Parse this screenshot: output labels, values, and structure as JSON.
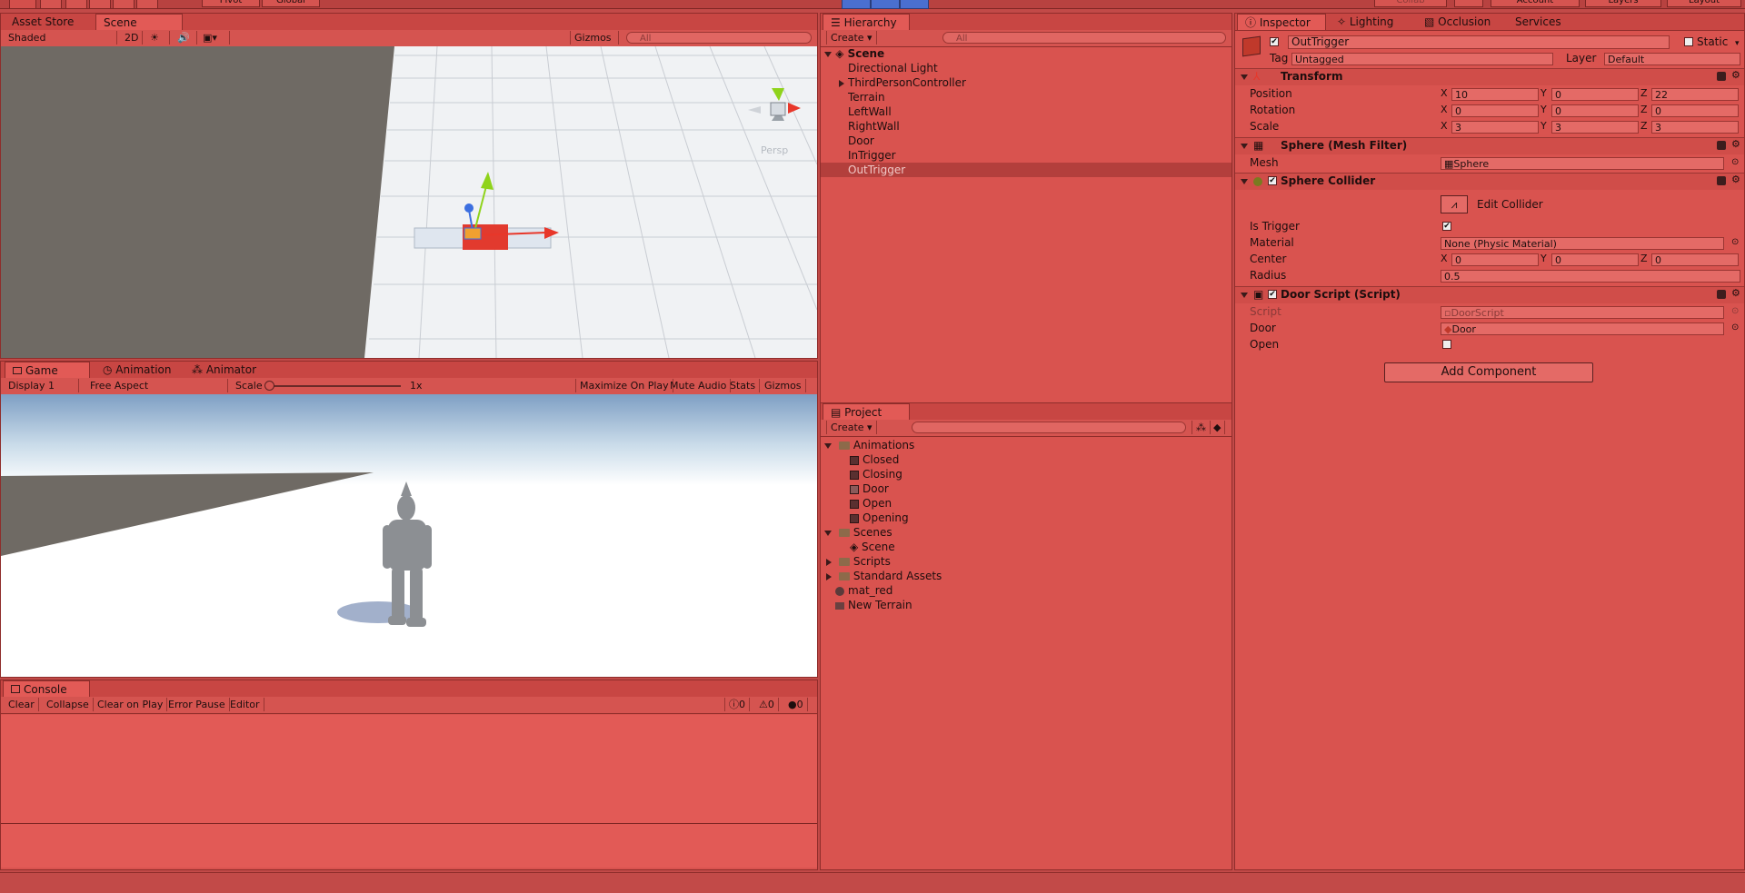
{
  "top_bar": {
    "pivot_label": "Pivot",
    "global_label": "Global",
    "collab_label": "Collab",
    "account_label": "Account",
    "layers_label": "Layers",
    "layout_label": "Layout"
  },
  "scene_panel": {
    "tabs": [
      "Asset Store",
      "Scene"
    ],
    "shading_mode": "Shaded",
    "mode_2d": "2D",
    "gizmos_label": "Gizmos",
    "search_placeholder": "All",
    "persp_label": "Persp"
  },
  "game_panel": {
    "tabs": [
      "Game",
      "Animation",
      "Animator"
    ],
    "display": "Display 1",
    "aspect": "Free Aspect",
    "scale_label": "Scale",
    "scale_value": "1x",
    "maximize_on_play": "Maximize On Play",
    "mute_audio": "Mute Audio",
    "stats": "Stats",
    "gizmos": "Gizmos"
  },
  "console_panel": {
    "tab": "Console",
    "clear": "Clear",
    "collapse": "Collapse",
    "clear_on_play": "Clear on Play",
    "error_pause": "Error Pause",
    "editor": "Editor",
    "error_count": "0",
    "warning_count": "0",
    "log_count": "0"
  },
  "hierarchy": {
    "tab": "Hierarchy",
    "create_label": "Create",
    "search_placeholder": "All",
    "scene_name": "Scene",
    "items": [
      {
        "label": "Directional Light",
        "expandable": false,
        "selected": false
      },
      {
        "label": "ThirdPersonController",
        "expandable": true,
        "selected": false
      },
      {
        "label": "Terrain",
        "expandable": false,
        "selected": false
      },
      {
        "label": "LeftWall",
        "expandable": false,
        "selected": false
      },
      {
        "label": "RightWall",
        "expandable": false,
        "selected": false
      },
      {
        "label": "Door",
        "expandable": false,
        "selected": false
      },
      {
        "label": "InTrigger",
        "expandable": false,
        "selected": false
      },
      {
        "label": "OutTrigger",
        "expandable": false,
        "selected": true
      }
    ]
  },
  "project": {
    "tab": "Project",
    "create_label": "Create",
    "folders": {
      "animations": "Animations",
      "animation_items": [
        "Closed",
        "Closing",
        "Door",
        "Open",
        "Opening"
      ],
      "scenes": "Scenes",
      "scene_items": [
        "Scene"
      ],
      "scripts": "Scripts",
      "standard_assets": "Standard Assets",
      "mat_red": "mat_red",
      "new_terrain": "New Terrain"
    }
  },
  "inspector": {
    "tabs": [
      "Inspector",
      "Lighting",
      "Occlusion",
      "Services"
    ],
    "object_name": "OutTrigger",
    "static_label": "Static",
    "tag_label": "Tag",
    "tag_value": "Untagged",
    "layer_label": "Layer",
    "layer_value": "Default",
    "transform": {
      "title": "Transform",
      "position_label": "Position",
      "rotation_label": "Rotation",
      "scale_label": "Scale",
      "position": {
        "x": "10",
        "y": "0",
        "z": "22"
      },
      "rotation": {
        "x": "0",
        "y": "0",
        "z": "0"
      },
      "scale": {
        "x": "3",
        "y": "3",
        "z": "3"
      }
    },
    "mesh_filter": {
      "title": "Sphere (Mesh Filter)",
      "mesh_label": "Mesh",
      "mesh_value": "Sphere"
    },
    "sphere_collider": {
      "title": "Sphere Collider",
      "edit_collider": "Edit Collider",
      "is_trigger_label": "Is Trigger",
      "material_label": "Material",
      "material_value": "None (Physic Material)",
      "center_label": "Center",
      "center": {
        "x": "0",
        "y": "0",
        "z": "0"
      },
      "radius_label": "Radius",
      "radius_value": "0.5"
    },
    "door_script": {
      "title": "Door Script (Script)",
      "script_label": "Script",
      "script_value": "DoorScript",
      "door_label": "Door",
      "door_value": "Door",
      "open_label": "Open"
    },
    "add_component": "Add Component"
  },
  "axis_labels": {
    "x": "X",
    "y": "Y",
    "z": "Z"
  },
  "colors": {
    "panel_bg": "#d9534f",
    "selection": "#b33f3c",
    "axis_x": "#e8372a",
    "axis_y": "#8fd31b",
    "axis_z": "#3c6fe0"
  }
}
